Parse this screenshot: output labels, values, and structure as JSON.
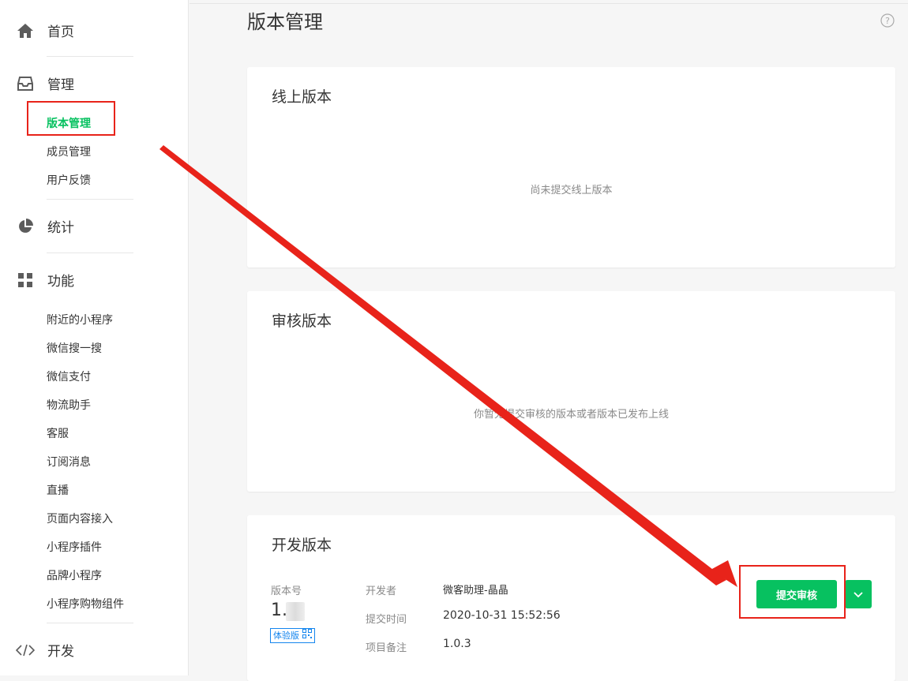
{
  "sidebar": {
    "home": {
      "label": "首页",
      "icon": "home-icon"
    },
    "manage": {
      "label": "管理",
      "icon": "inbox-icon",
      "items": [
        {
          "label": "版本管理",
          "active": true
        },
        {
          "label": "成员管理"
        },
        {
          "label": "用户反馈"
        }
      ]
    },
    "stats": {
      "label": "统计",
      "icon": "pie-chart-icon"
    },
    "features": {
      "label": "功能",
      "icon": "grid-icon",
      "items": [
        {
          "label": "附近的小程序"
        },
        {
          "label": "微信搜一搜"
        },
        {
          "label": "微信支付"
        },
        {
          "label": "物流助手"
        },
        {
          "label": "客服"
        },
        {
          "label": "订阅消息"
        },
        {
          "label": "直播"
        },
        {
          "label": "页面内容接入"
        },
        {
          "label": "小程序插件"
        },
        {
          "label": "品牌小程序"
        },
        {
          "label": "小程序购物组件"
        }
      ]
    },
    "dev": {
      "label": "开发",
      "icon": "code-icon"
    }
  },
  "main": {
    "title": "版本管理",
    "help_icon": "help-icon",
    "online": {
      "title": "线上版本",
      "empty": "尚未提交线上版本"
    },
    "review": {
      "title": "审核版本",
      "empty": "你暂无提交审核的版本或者版本已发布上线"
    },
    "dev": {
      "title": "开发版本",
      "version_label": "版本号",
      "version_value": "1.",
      "tag": "体验版",
      "developer_label": "开发者",
      "developer_value": "微客助理-晶晶",
      "submit_time_label": "提交时间",
      "submit_time_value": "2020-10-31 15:52:56",
      "remark_label": "项目备注",
      "remark_value": "1.0.3",
      "submit_button": "提交审核"
    }
  },
  "colors": {
    "accent": "#07c160",
    "annotation": "#e8231a",
    "tag": "#1485ee"
  }
}
